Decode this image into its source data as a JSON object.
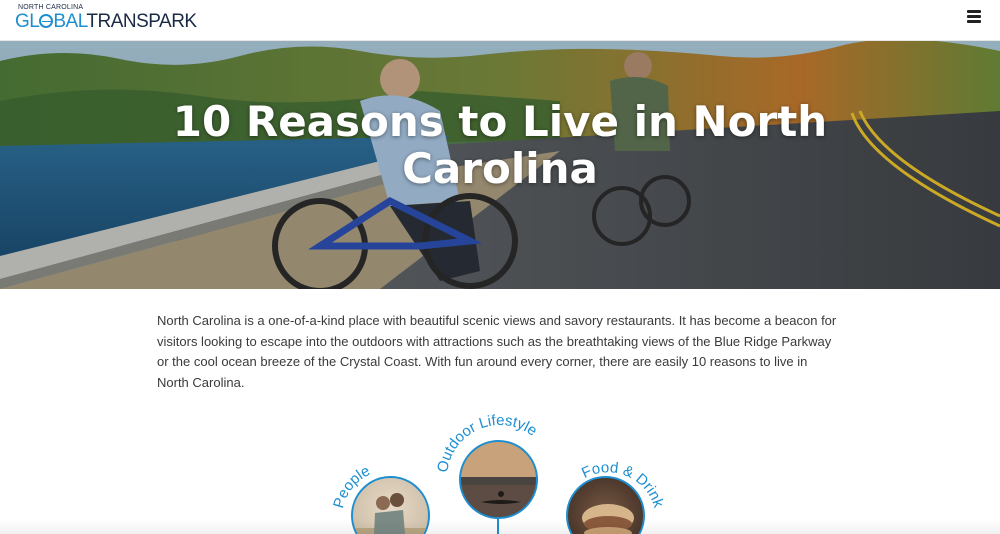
{
  "header": {
    "logo_top": "NORTH CAROLINA",
    "logo_left": "GL",
    "logo_mid": "BAL",
    "logo_right": "TRANSPARK",
    "menu_icon": "hamburger-menu-icon"
  },
  "hero": {
    "title": "10 Reasons to Live in North Carolina"
  },
  "intro": {
    "text": "North Carolina is a one-of-a-kind place with beautiful scenic views and savory restaurants. It has become a beacon for visitors looking to escape into the outdoors with attractions such as the breathtaking views of the Blue Ridge Parkway or the cool ocean breeze of the Crystal Coast. With fun around every corner, there are easily 10 reasons to live in North Carolina."
  },
  "reasons": [
    {
      "label": "People"
    },
    {
      "label": "Outdoor Lifestyle"
    },
    {
      "label": "Food & Drink"
    }
  ],
  "colors": {
    "accent": "#1d8fd1",
    "brand_dark": "#1b2a44",
    "text": "#3a3a3a"
  }
}
